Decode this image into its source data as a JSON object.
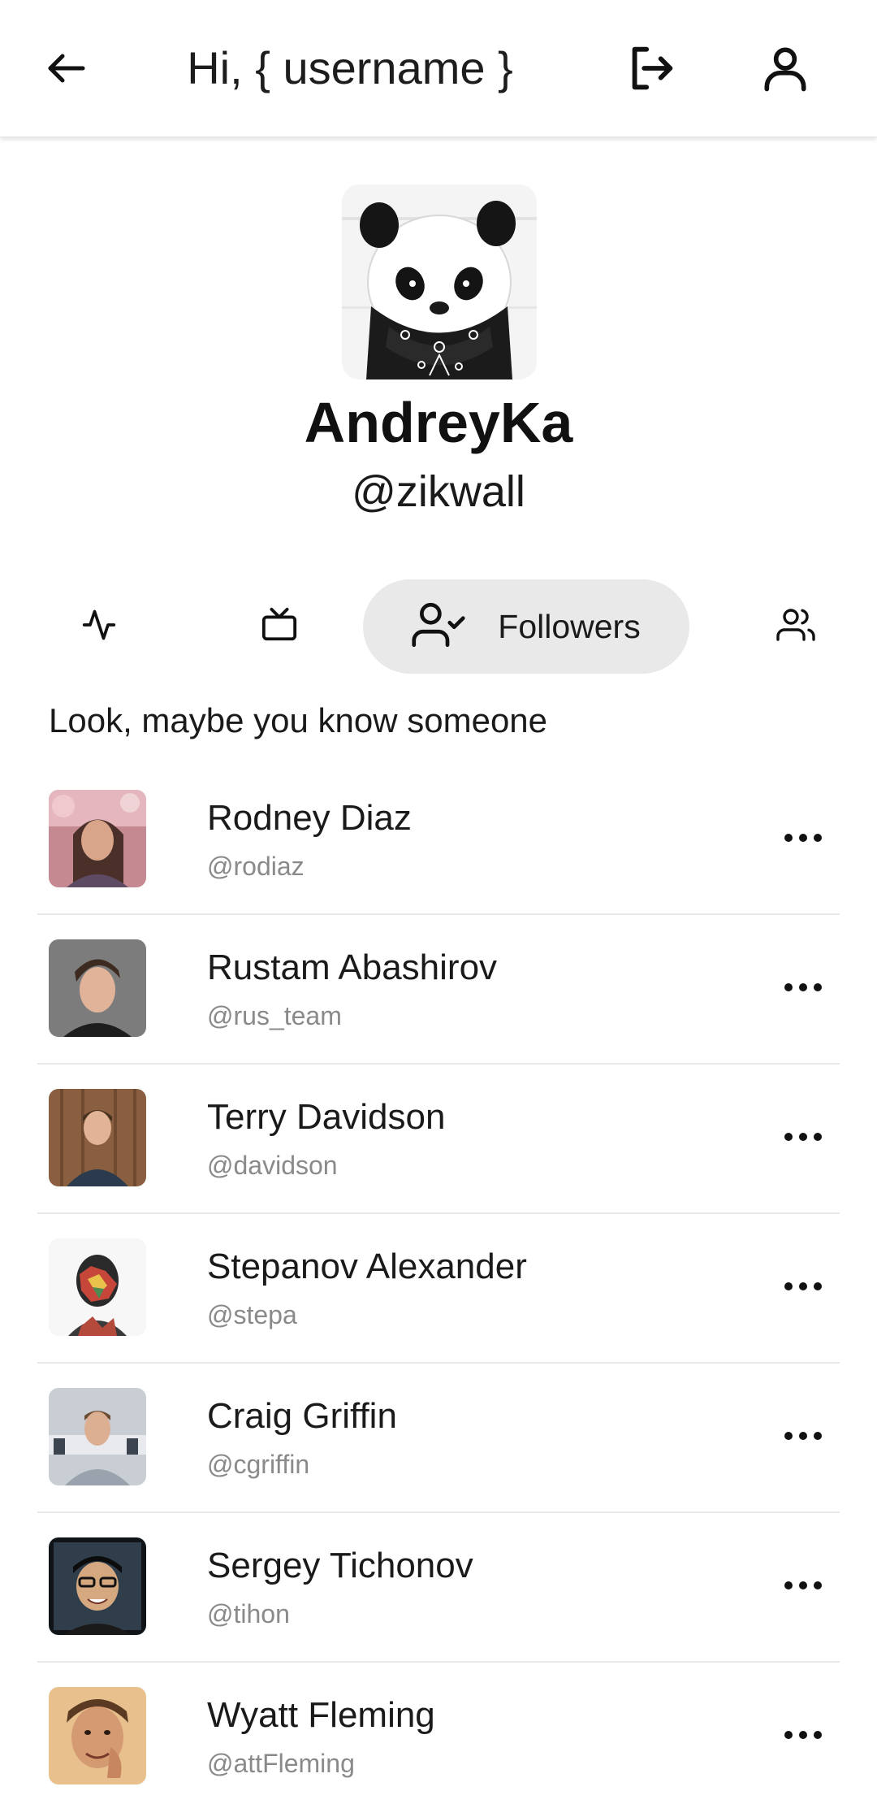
{
  "header": {
    "title": "Hi, { username }",
    "back_icon": "arrow-left-icon",
    "logout_icon": "logout-icon",
    "profile_icon": "user-icon"
  },
  "profile": {
    "name": "AndreyKa",
    "handle": "@zikwall",
    "avatar": "panda-with-bandana"
  },
  "tabs": [
    {
      "icon": "activity-icon",
      "label": "",
      "active": false
    },
    {
      "icon": "tv-icon",
      "label": "",
      "active": false
    },
    {
      "icon": "user-check-icon",
      "label": "Followers",
      "active": true
    },
    {
      "icon": "users-icon",
      "label": "",
      "active": false
    }
  ],
  "section": {
    "title": "Look, maybe you know someone"
  },
  "people": [
    {
      "name": "Rodney Diaz",
      "handle": "@rodiaz"
    },
    {
      "name": "Rustam Abashirov",
      "handle": "@rus_team"
    },
    {
      "name": "Terry Davidson",
      "handle": "@davidson"
    },
    {
      "name": "Stepanov Alexander",
      "handle": "@stepa"
    },
    {
      "name": "Craig Griffin",
      "handle": "@cgriffin"
    },
    {
      "name": "Sergey Tichonov",
      "handle": "@tihon"
    },
    {
      "name": "Wyatt Fleming",
      "handle": "@attFleming"
    }
  ],
  "colors": {
    "active_tab_bg": "#e9e9e9",
    "handle_text": "#8a8a8a",
    "divider": "#e8e8e8"
  }
}
